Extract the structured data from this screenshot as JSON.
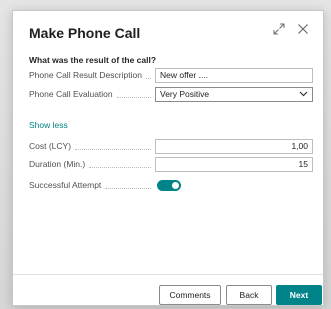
{
  "dialog": {
    "title": "Make Phone Call",
    "icons": {
      "expand": "expand-icon",
      "close": "close-icon"
    }
  },
  "form": {
    "question": "What was the result of the call?",
    "result_description": {
      "label": "Phone Call Result Description",
      "value": "New offer ...."
    },
    "evaluation": {
      "label": "Phone Call Evaluation",
      "value": "Very Positive"
    },
    "show_less": "Show less",
    "cost": {
      "label": "Cost (LCY)",
      "value": "1,00"
    },
    "duration": {
      "label": "Duration (Min.)",
      "value": "15"
    },
    "successful_attempt": {
      "label": "Successful Attempt",
      "checked": true
    }
  },
  "footer": {
    "comments": "Comments",
    "back": "Back",
    "next": "Next"
  },
  "colors": {
    "accent": "#00848a",
    "text": "#212121",
    "label": "#505050"
  }
}
